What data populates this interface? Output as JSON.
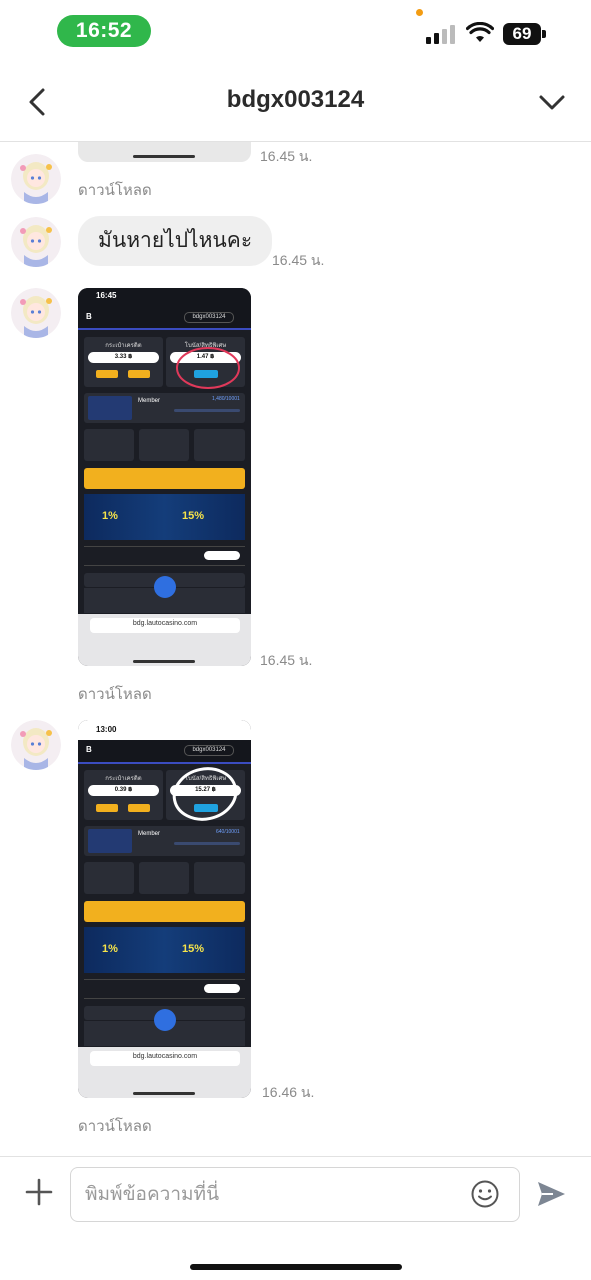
{
  "status_bar": {
    "time": "16:52",
    "battery": "69"
  },
  "header": {
    "title": "bdgx003124"
  },
  "messages": [
    {
      "type": "image",
      "timestamp": "16.45 น.",
      "caption": "ดาวน์โหลด"
    },
    {
      "type": "text",
      "text": "มันหายไปไหนคะ",
      "timestamp": "16.45 น."
    },
    {
      "type": "image",
      "timestamp": "16.45 น.",
      "caption": "ดาวน์โหลด",
      "screenshot": {
        "time": "16:45",
        "username": "bdgx003124",
        "wallet_label": "กระเป๋าเครดิต",
        "wallet_value": "3.33 ฿",
        "bonus_label": "โบนัส/สิทธิพิเศษ",
        "bonus_value": "1.47 ฿",
        "member": "Member",
        "score": "1,480/10001",
        "url": "bdg.lautocasino.com"
      }
    },
    {
      "type": "image",
      "timestamp": "16.46 น.",
      "caption": "ดาวน์โหลด",
      "screenshot": {
        "time": "13:00",
        "username": "bdgx003124",
        "wallet_label": "กระเป๋าเครดิต",
        "wallet_value": "0.39 ฿",
        "bonus_label": "โบนัส/สิทธิพิเศษ",
        "bonus_value": "15.27 ฿",
        "member": "Member",
        "score": "640/10001",
        "url": "bdg.lautocasino.com"
      }
    }
  ],
  "input": {
    "placeholder": "พิมพ์ข้อความที่นี่"
  },
  "icons": {
    "back": "chevron-left-icon",
    "menu": "chevron-down-icon",
    "add": "plus-icon",
    "emoji": "smiley-icon",
    "send": "send-icon"
  },
  "colors": {
    "time_pill": "#30b74b",
    "bubble": "#efefef",
    "shot_bg": "#1b1d24",
    "shot_accent": "#f2b01e",
    "circle_red": "#e0395a",
    "circle_white": "#ffffff"
  }
}
